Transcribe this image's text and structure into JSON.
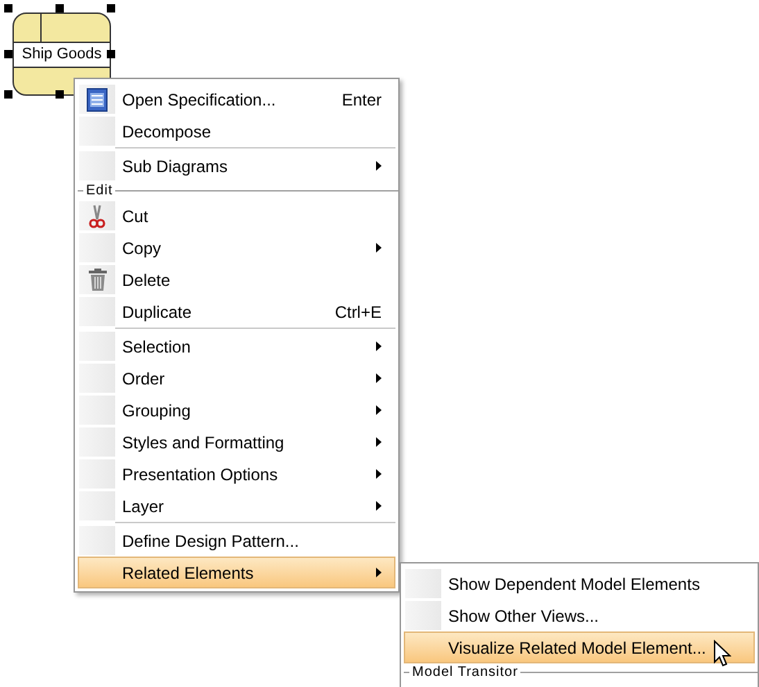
{
  "shape": {
    "label": "Ship Goods",
    "selected": true
  },
  "menu": {
    "items": [
      {
        "kind": "item",
        "label": "Open Specification...",
        "shortcut": "Enter",
        "submenu": false,
        "selected": false
      },
      {
        "kind": "item",
        "label": "Decompose",
        "submenu": false,
        "selected": false
      },
      {
        "kind": "separator"
      },
      {
        "kind": "item",
        "label": "Sub Diagrams",
        "submenu": true,
        "selected": false
      },
      {
        "kind": "section",
        "label": "Edit"
      },
      {
        "kind": "item",
        "label": "Cut",
        "submenu": false,
        "selected": false
      },
      {
        "kind": "item",
        "label": "Copy",
        "submenu": true,
        "selected": false
      },
      {
        "kind": "item",
        "label": "Delete",
        "submenu": false,
        "selected": false
      },
      {
        "kind": "item",
        "label": "Duplicate",
        "shortcut": "Ctrl+E",
        "submenu": false,
        "selected": false
      },
      {
        "kind": "separator"
      },
      {
        "kind": "item",
        "label": "Selection",
        "submenu": true,
        "selected": false
      },
      {
        "kind": "item",
        "label": "Order",
        "submenu": true,
        "selected": false
      },
      {
        "kind": "item",
        "label": "Grouping",
        "submenu": true,
        "selected": false
      },
      {
        "kind": "item",
        "label": "Styles and Formatting",
        "submenu": true,
        "selected": false
      },
      {
        "kind": "item",
        "label": "Presentation Options",
        "submenu": true,
        "selected": false
      },
      {
        "kind": "item",
        "label": "Layer",
        "submenu": true,
        "selected": false
      },
      {
        "kind": "separator"
      },
      {
        "kind": "item",
        "label": "Define Design Pattern...",
        "submenu": false,
        "selected": false
      },
      {
        "kind": "item",
        "label": "Related Elements",
        "submenu": true,
        "selected": true
      }
    ]
  },
  "submenu": {
    "items": [
      {
        "kind": "item",
        "label": "Show Dependent Model Elements",
        "submenu": false,
        "selected": false
      },
      {
        "kind": "item",
        "label": "Show Other Views...",
        "submenu": false,
        "selected": false
      },
      {
        "kind": "item",
        "label": "Visualize Related Model Element...",
        "submenu": false,
        "selected": true
      },
      {
        "kind": "section",
        "label": "Model Transitor"
      }
    ]
  }
}
